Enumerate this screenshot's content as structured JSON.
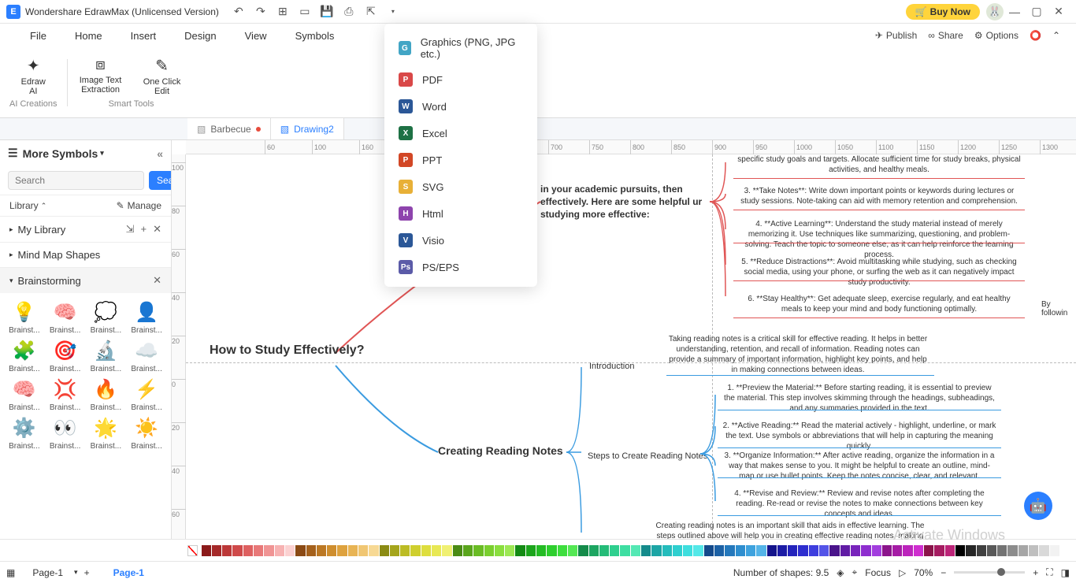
{
  "titlebar": {
    "app": "Wondershare EdrawMax (Unlicensed Version)",
    "buy": "Buy Now"
  },
  "menubar": {
    "items": [
      "File",
      "Home",
      "Insert",
      "Design",
      "View",
      "Symbols"
    ],
    "right": {
      "publish": "Publish",
      "share": "Share",
      "options": "Options"
    }
  },
  "toolbar": {
    "edraw_ai": "Edraw\nAI",
    "image_text": "Image Text\nExtraction",
    "one_click": "One Click\nEdit",
    "group1": "AI Creations",
    "group2": "Smart Tools"
  },
  "tabs": {
    "t1": "Barbecue",
    "t2": "Drawing2"
  },
  "sidebar": {
    "title": "More Symbols",
    "search_placeholder": "Search",
    "search_btn": "Search",
    "library": "Library",
    "manage": "Manage",
    "mylibrary": "My Library",
    "mindmap": "Mind Map Shapes",
    "brainstorming": "Brainstorming",
    "shape_label": "Brainst..."
  },
  "export": {
    "items": [
      {
        "label": "Graphics (PNG, JPG etc.)",
        "color": "#42a5c5",
        "ch": "G"
      },
      {
        "label": "PDF",
        "color": "#d94848",
        "ch": "P"
      },
      {
        "label": "Word",
        "color": "#2b5797",
        "ch": "W"
      },
      {
        "label": "Excel",
        "color": "#1e7145",
        "ch": "X"
      },
      {
        "label": "PPT",
        "color": "#d24726",
        "ch": "P"
      },
      {
        "label": "SVG",
        "color": "#e8b037",
        "ch": "S"
      },
      {
        "label": "Html",
        "color": "#8e44ad",
        "ch": "H"
      },
      {
        "label": "Visio",
        "color": "#2b5797",
        "ch": "V"
      },
      {
        "label": "PS/EPS",
        "color": "#5b5ba8",
        "ch": "Ps"
      }
    ]
  },
  "canvas": {
    "root": "How to Study Effectively?",
    "branch_header": "in your academic pursuits, then\neffectively. Here are some helpful\nur studying more effective:",
    "items_top": [
      "specific study goals and targets. Allocate sufficient time for study breaks, physical activities, and healthy meals.",
      "3. **Take Notes**: Write down important points or keywords during lectures or study sessions. Note-taking can aid with memory retention and comprehension.",
      "4. **Active Learning**: Understand the study material instead of merely memorizing it. Use techniques like summarizing, questioning, and problem-solving. Teach the topic to someone else, as it can help reinforce the learning process.",
      "5. **Reduce Distractions**: Avoid multitasking while studying, such as checking social media, using your phone, or surfing the web as it can negatively impact study productivity.",
      "6. **Stay Healthy**: Get adequate sleep, exercise regularly, and eat healthy meals to keep your mind and body functioning optimally."
    ],
    "by_following": "By followin",
    "branch2": "Creating Reading Notes",
    "introduction": "Introduction",
    "intro_text": "Taking reading notes is a critical skill for effective reading. It helps in better understanding, retention, and recall of information. Reading notes can provide a summary of important information, highlight key points, and help in making connections between ideas.",
    "steps_label": "Steps to Create Reading Notes",
    "items_bottom": [
      "1. **Preview the Material:** Before starting reading, it is essential to preview the material. This step involves skimming through the headings, subheadings, and any summaries provided in the text.",
      "2. **Active Reading:** Read the material actively - highlight, underline, or mark the text. Use symbols or abbreviations that will help in capturing the meaning quickly.",
      "3. **Organize Information:** After active reading, organize the information in a way that makes sense to you. It might be helpful to create an outline, mind-map or use bullet points. Keep the notes concise, clear, and relevant.",
      "4. **Revise and Review:** Review and revise notes after completing the reading. Re-read or revise the notes to make connections between key concepts and ideas."
    ],
    "conclusion": "Creating reading notes is an important skill that aids in effective learning. The steps outlined above will help you in creating effective reading notes, making learning more"
  },
  "colors": [
    "#8b1a1a",
    "#a52929",
    "#bc3838",
    "#cf4a4a",
    "#de6060",
    "#e87878",
    "#f09494",
    "#f7b2b2",
    "#fbd1d1",
    "#8b4a14",
    "#a5611c",
    "#bc7824",
    "#cf8e2e",
    "#dea23e",
    "#e8b454",
    "#f0c672",
    "#f7d994",
    "#8b8b14",
    "#a5a51c",
    "#bcbc24",
    "#cfcf2e",
    "#dede3e",
    "#e8e854",
    "#f0f072",
    "#4a8b14",
    "#5aa51c",
    "#6abc24",
    "#7acf2e",
    "#8ade3e",
    "#9de854",
    "#148b14",
    "#1ca51c",
    "#24bc24",
    "#2ecf2e",
    "#3ede3e",
    "#54e854",
    "#148b4a",
    "#1ca561",
    "#24bc78",
    "#2ecf8e",
    "#3edea2",
    "#54e8b4",
    "#148b8b",
    "#1ca5a5",
    "#24bcbc",
    "#2ecfcf",
    "#3edede",
    "#54e8e8",
    "#144a8b",
    "#1c61a5",
    "#2478bc",
    "#2e8ecf",
    "#3ea2de",
    "#54b4e8",
    "#14148b",
    "#1c1ca5",
    "#2424bc",
    "#2e2ecf",
    "#3e3ede",
    "#5454e8",
    "#4a148b",
    "#611ca5",
    "#7824bc",
    "#8e2ecf",
    "#a23ede",
    "#8b148b",
    "#a51ca5",
    "#bc24bc",
    "#cf2ecf",
    "#8b144a",
    "#a51c61",
    "#bc2478",
    "#000000",
    "#262626",
    "#404040",
    "#595959",
    "#737373",
    "#8c8c8c",
    "#a6a6a6",
    "#bfbfbf",
    "#d9d9d9",
    "#f2f2f2",
    "#ffffff"
  ],
  "status": {
    "page": "Page-1",
    "page_active": "Page-1",
    "shapes": "Number of shapes: 9.5",
    "focus": "Focus",
    "zoom": "70%"
  },
  "watermark": "Activate Windows"
}
